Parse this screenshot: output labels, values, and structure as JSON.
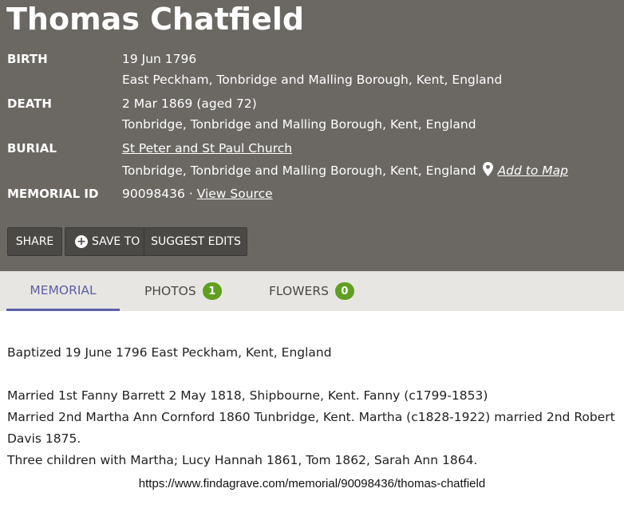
{
  "memorial": {
    "name": "Thomas Chatfield",
    "birth": {
      "label": "BIRTH",
      "date": "19 Jun 1796",
      "place": "East Peckham, Tonbridge and Malling Borough, Kent, England"
    },
    "death": {
      "label": "DEATH",
      "date": "2 Mar 1869 (aged 72)",
      "place": "Tonbridge, Tonbridge and Malling Borough, Kent, England"
    },
    "burial": {
      "label": "BURIAL",
      "cemetery": "St Peter and St Paul Church",
      "place": "Tonbridge, Tonbridge and Malling Borough, Kent, England",
      "add_to_map": "Add to Map"
    },
    "memorial_id": {
      "label": "MEMORIAL ID",
      "value": "90098436 ·",
      "view_source": "View Source"
    }
  },
  "actions": {
    "share": "SHARE",
    "save_to": "SAVE TO",
    "suggest_edits": "SUGGEST EDITS",
    "save_icon": "plus-circle-icon"
  },
  "tabs": {
    "memorial": "MEMORIAL",
    "photos": {
      "label": "PHOTOS",
      "count": "1"
    },
    "flowers": {
      "label": "FLOWERS",
      "count": "0"
    }
  },
  "bio": {
    "line1": "Baptized 19 June 1796 East Peckham, Kent, England",
    "line2": "Married 1st Fanny Barrett 2 May 1818, Shipbourne, Kent. Fanny (c1799-1853)",
    "line3": "Married 2nd Martha Ann Cornford 1860 Tunbridge, Kent. Martha (c1828-1922) married 2nd Robert",
    "line4": "Davis 1875.",
    "line5": "Three children with Martha; Lucy Hannah 1861, Tom 1862, Sarah Ann 1864."
  },
  "footer_url": "https://www.findagrave.com/memorial/90098436/thomas-chatfield",
  "colors": {
    "header_bg": "#6b6864",
    "button_bg": "#4b4946",
    "tab_active": "#5c5fa6",
    "badge": "#5fa020",
    "tabbar_bg": "#e8e6e2"
  }
}
